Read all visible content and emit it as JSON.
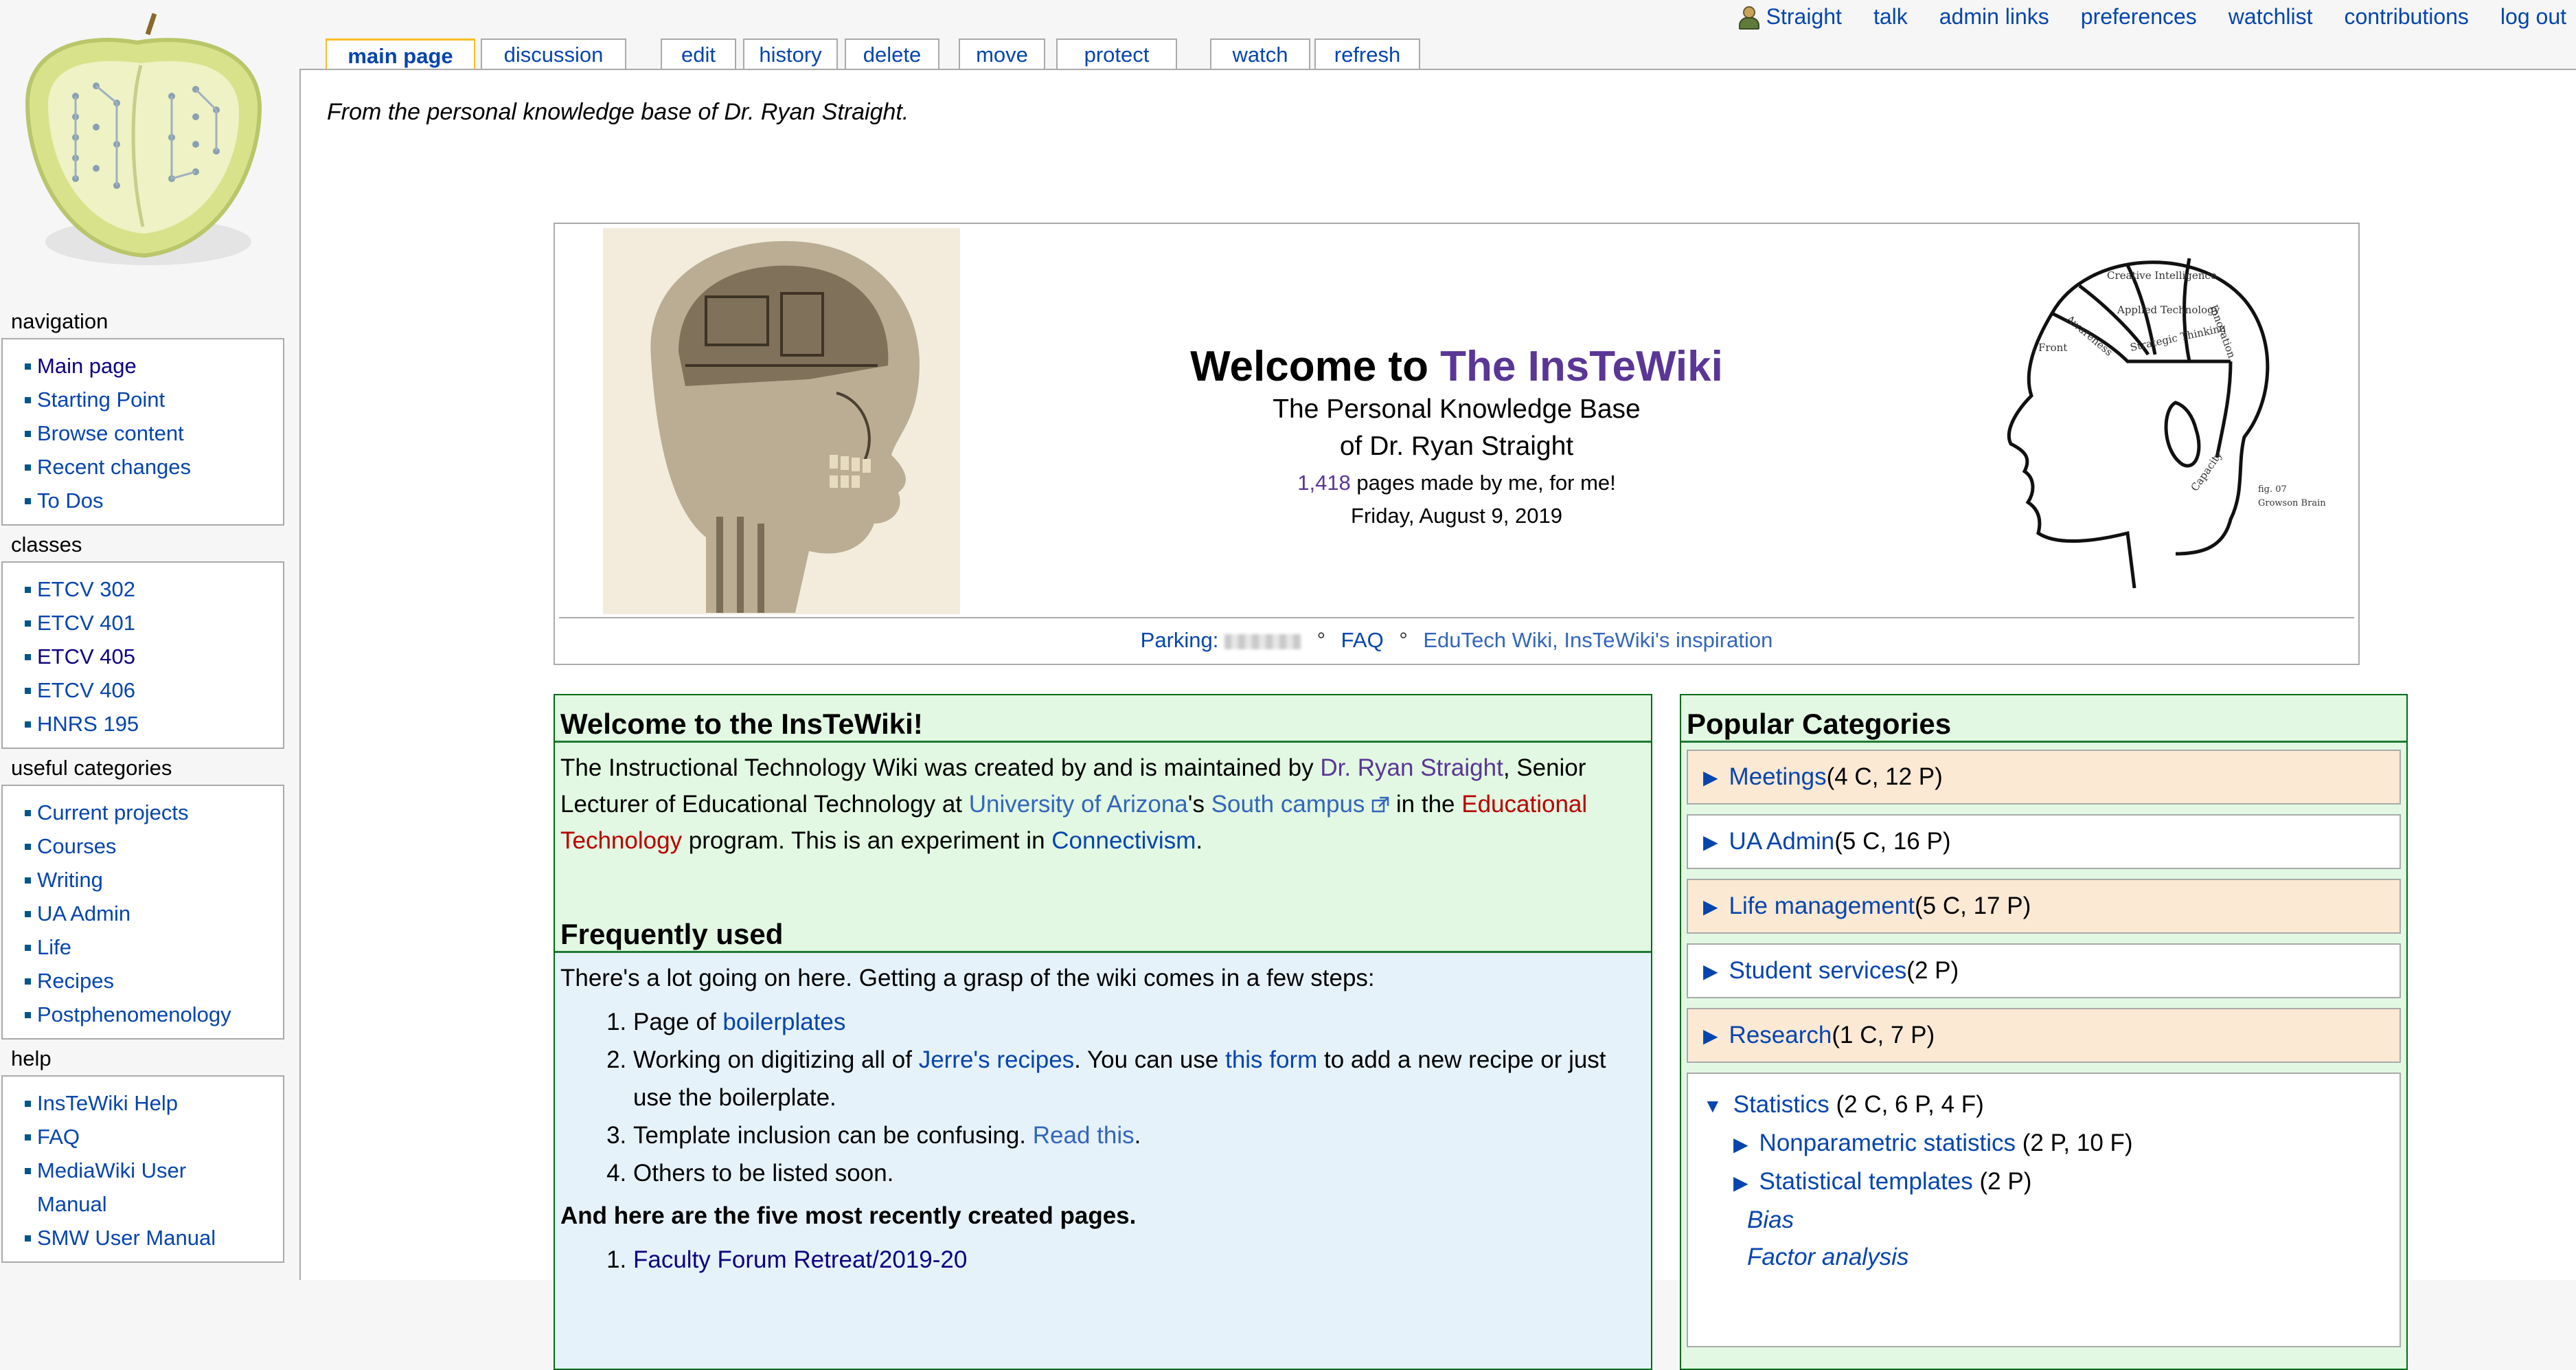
{
  "personal": {
    "user": "Straight",
    "links": [
      "talk",
      "admin links",
      "preferences",
      "watchlist",
      "contributions",
      "log out"
    ]
  },
  "tabs": [
    "main page",
    "discussion",
    "edit",
    "history",
    "delete",
    "move",
    "protect",
    "watch",
    "refresh"
  ],
  "tagline": "From the personal knowledge base of Dr. Ryan Straight.",
  "sidebar": {
    "navigation": {
      "title": "navigation",
      "items": [
        "Main page",
        "Starting Point",
        "Browse content",
        "Recent changes",
        "To Dos"
      ]
    },
    "classes": {
      "title": "classes",
      "items": [
        "ETCV 302",
        "ETCV 401",
        "ETCV 405",
        "ETCV 406",
        "HNRS 195"
      ]
    },
    "useful": {
      "title": "useful categories",
      "items": [
        "Current projects",
        "Courses",
        "Writing",
        "UA Admin",
        "Life",
        "Recipes",
        "Postphenomenology"
      ]
    },
    "help": {
      "title": "help",
      "items": [
        "InsTeWiki Help",
        "FAQ",
        "MediaWiki User",
        "Manual",
        "SMW User Manual"
      ]
    }
  },
  "banner": {
    "title_prefix": "Welcome to ",
    "title_link": "The InsTeWiki",
    "sub1": "The Personal Knowledge Base",
    "sub2": "of Dr. Ryan Straight",
    "count": "1,418",
    "count_suffix": " pages made by me, for me!",
    "date": "Friday, August 9, 2019",
    "footer": {
      "parking": "Parking:",
      "faq": "FAQ",
      "inspiration": "EduTech Wiki, InsTeWiki's inspiration",
      "sep": "°"
    },
    "phrenology_labels": [
      "Creative Intelligence",
      "Applied Technology",
      "Awareness",
      "Front",
      "Strategic Thinking",
      "Innovation",
      "Capacity",
      "fig. 07",
      "Growson Brain"
    ]
  },
  "welcome": {
    "heading": "Welcome to the InsTeWiki!",
    "p1": "The Instructional Technology Wiki was created by and is maintained by ",
    "author": "Dr. Ryan Straight",
    "p2": ", Senior Lecturer of Educational Technology at ",
    "uofa": "University of Arizona",
    "p3": "'s ",
    "south": "South campus",
    "p4": " in the ",
    "edtech": "Educational Technology",
    "p5": " program. This is an experiment in ",
    "conn": "Connectivism",
    "p6": "."
  },
  "frequent": {
    "heading": "Frequently used",
    "intro": "There's a lot going on here. Getting a grasp of the wiki comes in a few steps:",
    "i1a": "Page of ",
    "i1b": "boilerplates",
    "i2a": "Working on digitizing all of ",
    "i2b": "Jerre's recipes",
    "i2c": ". You can use ",
    "i2d": "this form",
    "i2e": " to add a new recipe or just use the boilerplate.",
    "i3a": "Template inclusion can be confusing. ",
    "i3b": "Read this",
    "i3c": ".",
    "i4": "Others to be listed soon.",
    "recent_heading": "And here are the five most recently created pages.",
    "recent": [
      "Faculty Forum Retreat/2019-20"
    ]
  },
  "popular": {
    "heading": "Popular Categories",
    "cats": [
      {
        "name": "Meetings",
        "count": " (4 C, 12 P)"
      },
      {
        "name": "UA Admin",
        "count": " (5 C, 16 P)"
      },
      {
        "name": "Life management",
        "count": " (5 C, 17 P)"
      },
      {
        "name": "Student services",
        "count": " (2 P)"
      },
      {
        "name": "Research",
        "count": " (1 C, 7 P)"
      }
    ],
    "open": {
      "name": "Statistics",
      "count": " (2 C, 6 P, 4 F)",
      "subs": [
        {
          "name": "Nonparametric statistics",
          "count": " (2 P, 10 F)"
        },
        {
          "name": "Statistical templates",
          "count": " (2 P)"
        }
      ],
      "pages": [
        "Bias",
        "Factor analysis"
      ]
    },
    "arrow_closed": "▶",
    "arrow_open": "▼"
  }
}
